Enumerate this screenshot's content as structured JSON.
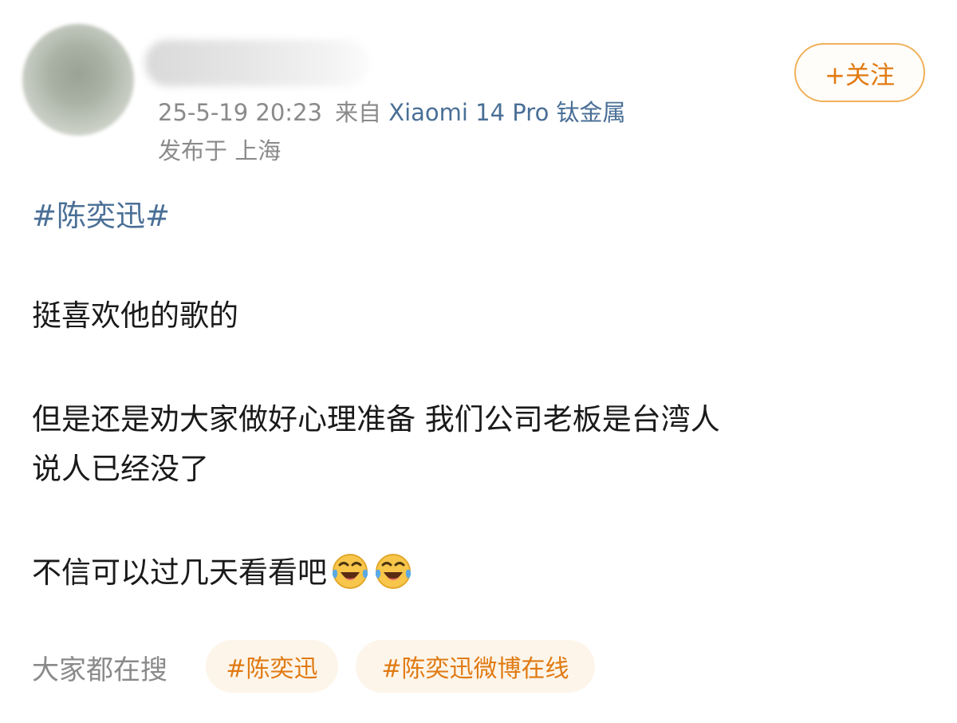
{
  "post": {
    "timestamp": "25-5-19 20:23",
    "source_prefix": "来自",
    "device": "Xiaomi 14 Pro 钛金属",
    "location": "发布于 上海",
    "follow_label": "+关注",
    "topic": "#陈奕迅#",
    "paragraphs": [
      "挺喜欢他的歌的",
      "但是还是劝大家做好心理准备  我们公司老板是台湾人",
      "说人已经没了",
      "不信可以过几天看看吧"
    ],
    "emojis": [
      "laugh-cry-icon",
      "laugh-cry-icon"
    ]
  },
  "trending": {
    "label": "大家都在搜",
    "chips": [
      "#陈奕迅",
      "#陈奕迅微博在线"
    ]
  },
  "colors": {
    "link_blue": "#4a6f96",
    "accent_orange": "#e07a12",
    "meta_gray": "#8a8a8a",
    "chip_bg": "#fdf5ea"
  }
}
